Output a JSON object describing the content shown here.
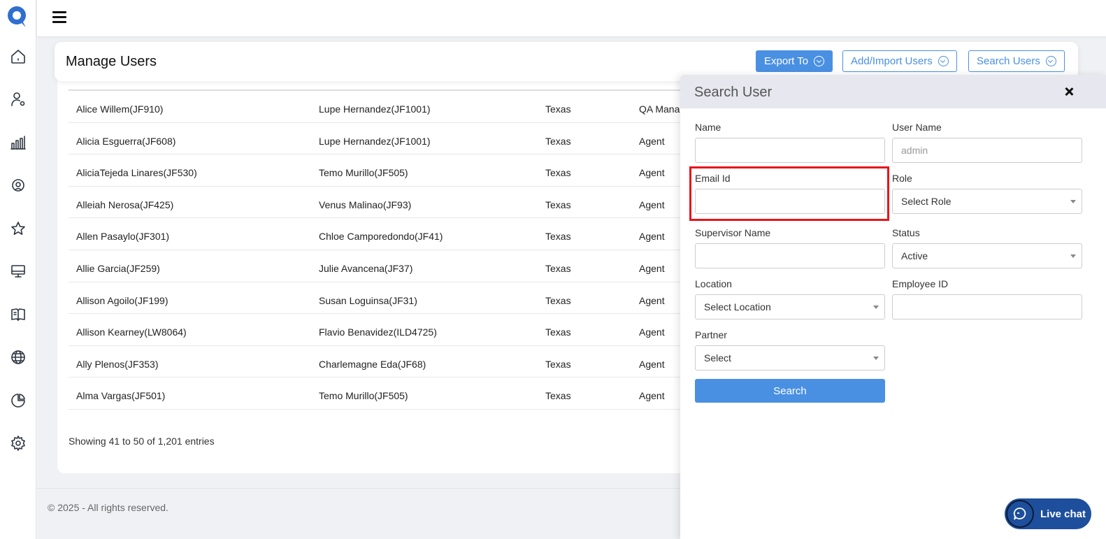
{
  "page": {
    "title": "Manage Users"
  },
  "header_buttons": {
    "export": "Export To",
    "add_import": "Add/Import Users",
    "search_users": "Search Users"
  },
  "sidebar": {
    "icons": [
      "home-icon",
      "user-settings-icon",
      "bar-chart-icon",
      "headset-icon",
      "star-icon",
      "monitor-icon",
      "book-icon",
      "globe-icon",
      "pie-chart-icon",
      "gear-icon"
    ]
  },
  "table": {
    "rows": [
      [
        "Alice Willem(JF910)",
        "Lupe Hernandez(JF1001)",
        "Texas",
        "QA Mana"
      ],
      [
        "Alicia Esguerra(JF608)",
        "Lupe Hernandez(JF1001)",
        "Texas",
        "Agent"
      ],
      [
        "AliciaTejeda Linares(JF530)",
        "Temo Murillo(JF505)",
        "Texas",
        "Agent"
      ],
      [
        "Alleiah Nerosa(JF425)",
        "Venus Malinao(JF93)",
        "Texas",
        "Agent"
      ],
      [
        "Allen Pasaylo(JF301)",
        "Chloe Camporedondo(JF41)",
        "Texas",
        "Agent"
      ],
      [
        "Allie Garcia(JF259)",
        "Julie Avancena(JF37)",
        "Texas",
        "Agent"
      ],
      [
        "Allison Agoilo(JF199)",
        "Susan Loguinsa(JF31)",
        "Texas",
        "Agent"
      ],
      [
        "Allison Kearney(LW8064)",
        "Flavio Benavidez(ILD4725)",
        "Texas",
        "Agent"
      ],
      [
        "Ally Plenos(JF353)",
        "Charlemagne Eda(JF68)",
        "Texas",
        "Agent"
      ],
      [
        "Alma Vargas(JF501)",
        "Temo Murillo(JF505)",
        "Texas",
        "Agent"
      ]
    ],
    "showing": "Showing 41 to 50 of 1,201 entries"
  },
  "footer": {
    "text": "© 2025 - All rights reserved."
  },
  "search_panel": {
    "title": "Search User",
    "name_label": "Name",
    "name_value": "",
    "username_label": "User Name",
    "username_placeholder": "admin",
    "email_label": "Email Id",
    "email_value": "",
    "role_label": "Role",
    "role_value": "Select Role",
    "supervisor_label": "Supervisor Name",
    "supervisor_value": "",
    "status_label": "Status",
    "status_value": "Active",
    "location_label": "Location",
    "location_value": "Select Location",
    "employee_id_label": "Employee ID",
    "employee_id_value": "",
    "partner_label": "Partner",
    "partner_value": "Select",
    "search_button": "Search"
  },
  "live_chat": {
    "label": "Live chat"
  },
  "colors": {
    "primary": "#4a90e2",
    "highlight": "#e8151b",
    "live_chat": "#1e4f9c"
  }
}
